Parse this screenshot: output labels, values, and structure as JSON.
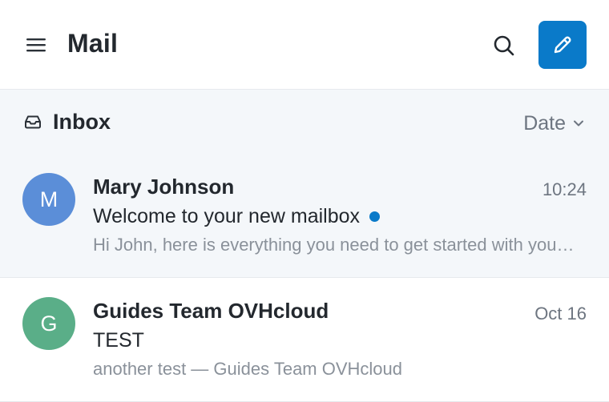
{
  "header": {
    "title": "Mail",
    "menu_icon": "hamburger-menu-icon",
    "search_icon": "search-icon",
    "compose_icon": "pencil-icon"
  },
  "folder": {
    "name": "Inbox",
    "icon": "inbox-tray-icon",
    "sort_label": "Date",
    "sort_icon": "chevron-down-icon"
  },
  "messages": [
    {
      "initial": "M",
      "avatar_color": "#5b8ed8",
      "sender": "Mary Johnson",
      "time": "10:24",
      "subject": "Welcome to your new mailbox",
      "unread": true,
      "preview": "Hi John, here is everything you need to get started with your new mailbox."
    },
    {
      "initial": "G",
      "avatar_color": "#5aae88",
      "sender": "Guides Team OVHcloud",
      "time": "Oct 16",
      "subject": "TEST",
      "unread": false,
      "preview": "another test — Guides Team OVHcloud"
    }
  ],
  "colors": {
    "accent": "#0a7ac9",
    "selected_bg": "#f4f7fa"
  }
}
